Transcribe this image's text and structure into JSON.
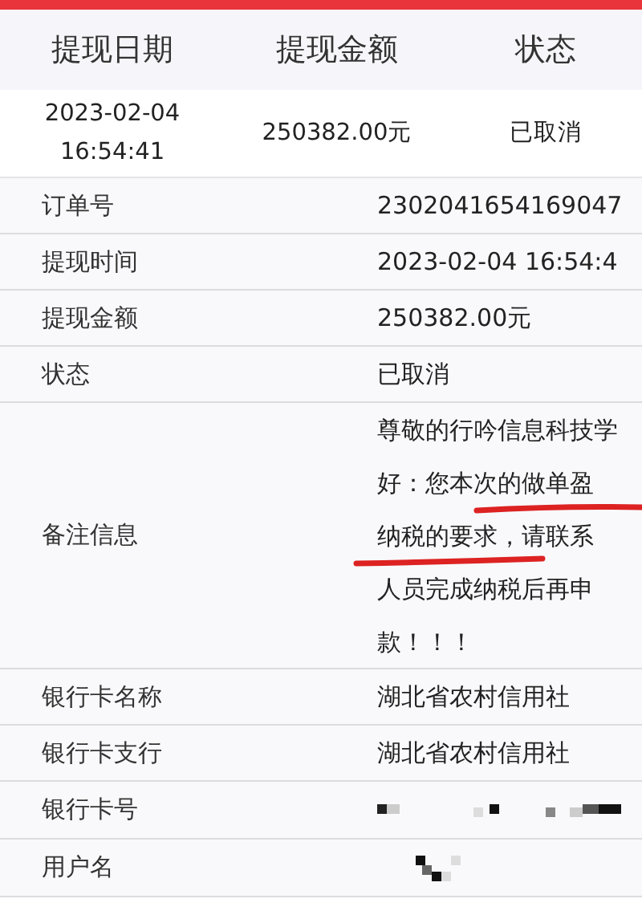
{
  "summary_table": {
    "columns": [
      "提现日期",
      "提现金额",
      "状态"
    ],
    "rows": [
      {
        "date": [
          "2023-02-04",
          "16:54:41"
        ],
        "amount": "250382.00元",
        "status": "已取消"
      }
    ]
  },
  "details": [
    {
      "kind": "text",
      "label": "订单号",
      "value": "2302041654169047"
    },
    {
      "kind": "text",
      "label": "提现时间",
      "value": "2023-02-04 16:54:4"
    },
    {
      "kind": "text",
      "label": "提现金额",
      "value": "250382.00元"
    },
    {
      "kind": "text",
      "label": "状态",
      "value": "已取消"
    },
    {
      "kind": "note",
      "label": "备注信息",
      "lines": [
        "尊敬的行吟信息科技学",
        "好：您本次的做单盈",
        "纳税的要求，请联系",
        "人员完成纳税后再申",
        "款！！！"
      ]
    },
    {
      "kind": "text",
      "label": "银行卡名称",
      "value": "湖北省农村信用社"
    },
    {
      "kind": "text",
      "label": "银行卡支行",
      "value": "湖北省农村信用社"
    },
    {
      "kind": "masked",
      "label": "银行卡号"
    },
    {
      "kind": "masked",
      "label": "用户名"
    }
  ]
}
